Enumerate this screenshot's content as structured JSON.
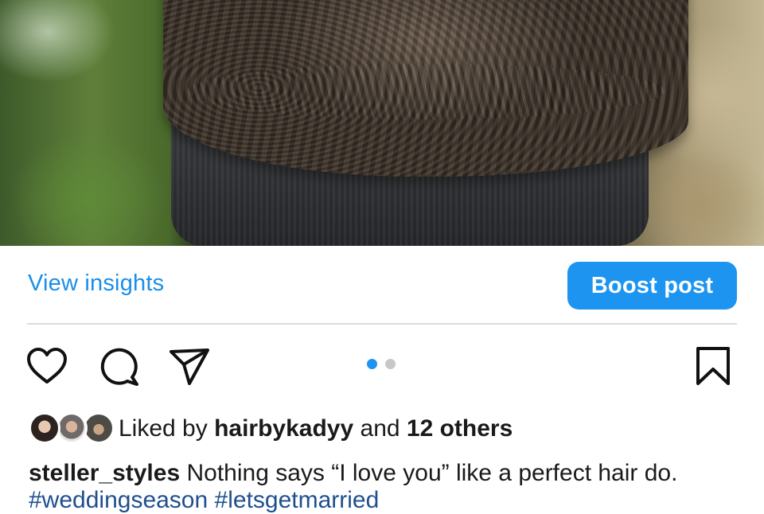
{
  "post": {
    "image_alt": "Back view of wavy brown hair styled over a black ribbed top"
  },
  "insights": {
    "view_insights_label": "View insights",
    "boost_label": "Boost post"
  },
  "actions": {
    "like_icon": "heart-icon",
    "comment_icon": "comment-icon",
    "share_icon": "paper-plane-icon",
    "save_icon": "bookmark-icon"
  },
  "carousel": {
    "total": 2,
    "active": 1
  },
  "likes": {
    "prefix": "Liked by ",
    "user": "hairbykadyy",
    "connector": " and ",
    "others": "12 others"
  },
  "caption": {
    "username": "steller_styles",
    "text": " Nothing says “I love you” like a perfect hair do.",
    "hashtags": [
      "#weddingseason",
      "#letsgetmarried"
    ]
  },
  "colors": {
    "accent": "#1d95f0",
    "link": "#1b8ee8",
    "hashtag": "#1f4f8e",
    "divider": "#dbdbdb"
  }
}
